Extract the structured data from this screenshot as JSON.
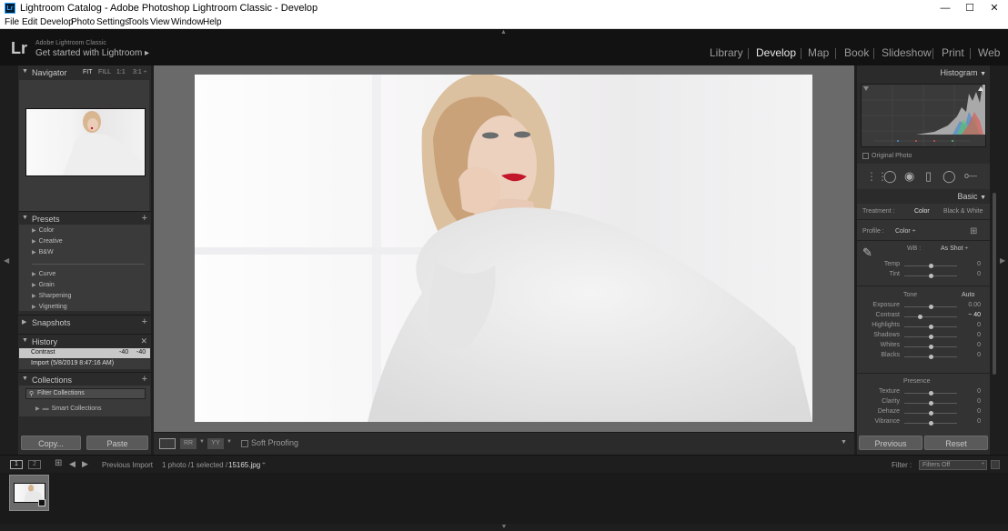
{
  "window": {
    "title": "Lightroom Catalog - Adobe Photoshop Lightroom Classic - Develop",
    "app_icon_text": "Lr",
    "minimize": "—",
    "maximize": "☐",
    "close": "✕"
  },
  "menu": [
    "File",
    "Edit",
    "Develop",
    "Photo",
    "Settings",
    "Tools",
    "View",
    "Window",
    "Help"
  ],
  "identity": {
    "logo": "Lr",
    "product": "Adobe Lightroom Classic",
    "tagline": "Get started with Lightroom ▸"
  },
  "modules": [
    "Library",
    "Develop",
    "Map",
    "Book",
    "Slideshow",
    "Print",
    "Web"
  ],
  "active_module": "Develop",
  "navigator": {
    "title": "Navigator",
    "options": [
      "FIT",
      "FILL",
      "1:1",
      "3:1 ÷"
    ]
  },
  "presets": {
    "title": "Presets",
    "items": [
      "Color",
      "Creative",
      "B&W",
      "Curve",
      "Grain",
      "Sharpening",
      "Vignetting"
    ]
  },
  "snapshots": {
    "title": "Snapshots"
  },
  "history": {
    "title": "History",
    "items": [
      {
        "label": "Contrast",
        "v1": "-40",
        "v2": "-40"
      },
      {
        "label": "Import (5/8/2019 8:47:16 AM)",
        "v1": "",
        "v2": ""
      }
    ]
  },
  "collections": {
    "title": "Collections",
    "filter_placeholder": "Filter Collections",
    "items": [
      "Smart Collections"
    ]
  },
  "left_buttons": {
    "copy": "Copy...",
    "paste": "Paste"
  },
  "toolbar": {
    "soft_proofing": "Soft Proofing",
    "view_icons": [
      "▭",
      "RR",
      "YY"
    ]
  },
  "right_panel": {
    "histogram_title": "Histogram",
    "original_photo": "Original Photo",
    "basic_title": "Basic",
    "treatment_label": "Treatment :",
    "treatment_color": "Color",
    "treatment_bw": "Black & White",
    "profile_label": "Profile :",
    "profile_value": "Color ÷",
    "wb_label": "WB :",
    "wb_value": "As Shot ÷",
    "sliders_wb": [
      {
        "label": "Temp",
        "value": "0",
        "pos": 0.5
      },
      {
        "label": "Tint",
        "value": "0",
        "pos": 0.5
      }
    ],
    "tone_label": "Tone",
    "auto_label": "Auto",
    "sliders_tone": [
      {
        "label": "Exposure",
        "value": "0.00",
        "pos": 0.5
      },
      {
        "label": "Contrast",
        "value": "− 40",
        "pos": 0.3
      },
      {
        "label": "Highlights",
        "value": "0",
        "pos": 0.5
      },
      {
        "label": "Shadows",
        "value": "0",
        "pos": 0.5
      },
      {
        "label": "Whites",
        "value": "0",
        "pos": 0.5
      },
      {
        "label": "Blacks",
        "value": "0",
        "pos": 0.5
      }
    ],
    "presence_label": "Presence",
    "sliders_presence": [
      {
        "label": "Texture",
        "value": "0",
        "pos": 0.5
      },
      {
        "label": "Clarity",
        "value": "0",
        "pos": 0.5
      },
      {
        "label": "Dehaze",
        "value": "0",
        "pos": 0.5
      },
      {
        "label": "Vibrance",
        "value": "0",
        "pos": 0.5
      }
    ],
    "previous": "Previous",
    "reset": "Reset"
  },
  "filmstrip_bar": {
    "view1": "1",
    "view2": "2",
    "source": "Previous Import",
    "count": "1 photo /1 selected /",
    "file": "15165.jpg",
    "file_dropdown": "÷",
    "filter_label": "Filter :",
    "filter_value": "Filters Off"
  },
  "colors": {
    "accent": "#31a8ff",
    "panel": "#2b2b2b",
    "background": "#1e1e1e"
  }
}
